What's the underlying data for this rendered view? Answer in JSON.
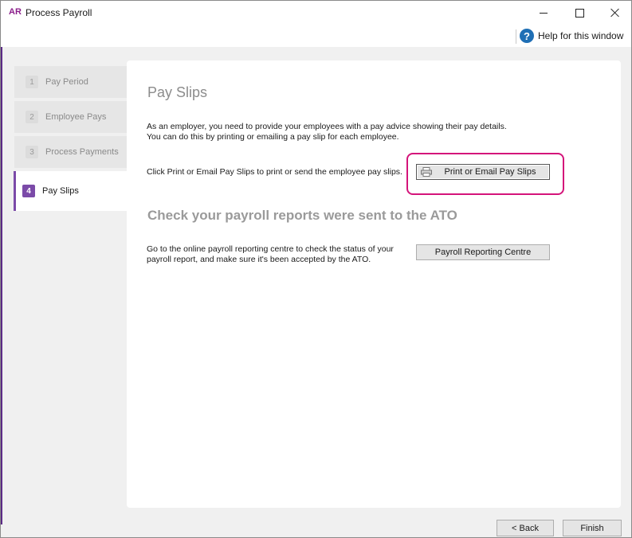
{
  "window": {
    "logo": "AR",
    "title": "Process Payroll",
    "help_label": "Help for this window"
  },
  "steps": [
    {
      "num": "1",
      "label": "Pay Period"
    },
    {
      "num": "2",
      "label": "Employee Pays"
    },
    {
      "num": "3",
      "label": "Process Payments"
    },
    {
      "num": "4",
      "label": "Pay Slips"
    }
  ],
  "main": {
    "heading": "Pay Slips",
    "intro_line1": "As an employer, you need to provide your employees with a pay advice showing their pay details.",
    "intro_line2": "You can do this by printing or emailing a pay slip for each employee.",
    "print_instruction": "Click Print or Email Pay Slips to print or send the employee pay slips.",
    "print_button": "Print or Email Pay Slips",
    "ato_heading": "Check your payroll reports were sent to the ATO",
    "ato_line1": "Go to the online payroll reporting centre to check the status of your",
    "ato_line2": "payroll report, and make sure it's been accepted by the ATO.",
    "payroll_button": "Payroll Reporting Centre"
  },
  "footer": {
    "back_label": "< Back",
    "finish_label": "Finish"
  },
  "colors": {
    "accent": "#7b4aa8",
    "highlight": "#d4147a",
    "help_icon": "#1f6fb5"
  },
  "icons": [
    "help-icon",
    "printer-icon",
    "minimize-icon",
    "maximize-icon",
    "close-icon"
  ]
}
